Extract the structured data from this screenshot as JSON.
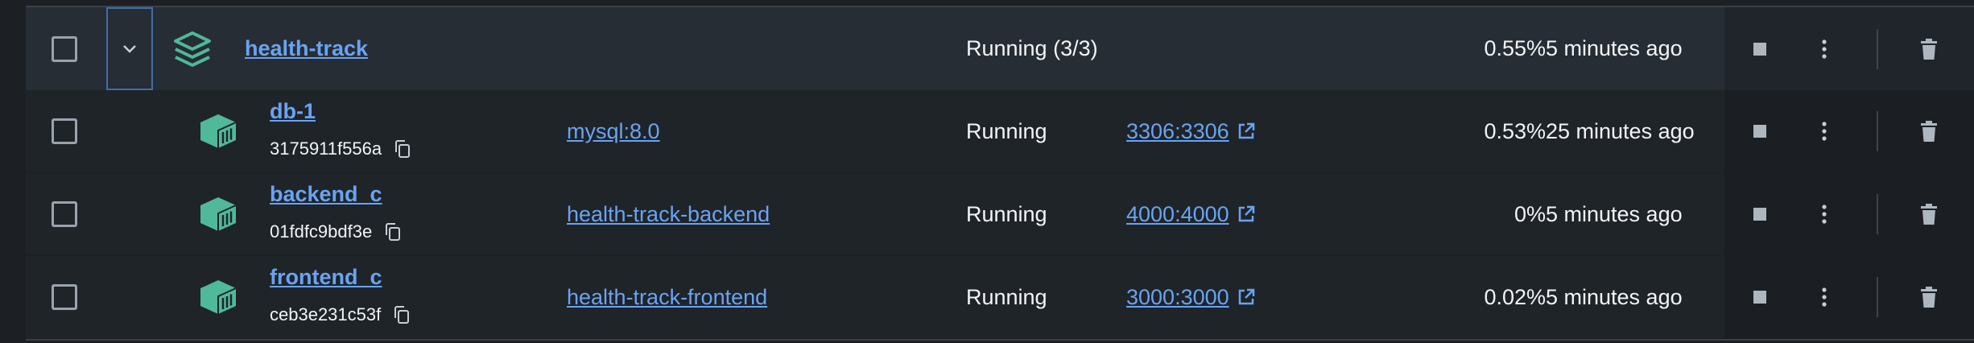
{
  "group": {
    "name": "health-track",
    "status": "Running (3/3)",
    "cpu": "0.55%",
    "last_started": "5 minutes ago"
  },
  "containers": [
    {
      "name": "db-1",
      "id": "3175911f556a",
      "image": "mysql:8.0",
      "status": "Running",
      "port": "3306:3306",
      "cpu": "0.53%",
      "last_started": "25 minutes ago"
    },
    {
      "name": "backend_c",
      "id": "01fdfc9bdf3e",
      "image": "health-track-backend",
      "status": "Running",
      "port": "4000:4000",
      "cpu": "0%",
      "last_started": "5 minutes ago"
    },
    {
      "name": "frontend_c",
      "id": "ceb3e231c53f",
      "image": "health-track-frontend",
      "status": "Running",
      "port": "3000:3000",
      "cpu": "0.02%",
      "last_started": "5 minutes ago"
    }
  ],
  "icons": {
    "group": "stack-layers-icon",
    "container": "container-cube-icon",
    "expand": "chevron-down-icon",
    "copy": "copy-icon",
    "external": "external-link-icon",
    "stop": "stop-icon",
    "more": "more-vertical-icon",
    "delete": "trash-icon"
  },
  "colors": {
    "accent_link": "#6aa3f2",
    "container_icon": "#4fb99a",
    "group_row_bg": "#272d35",
    "row_bg": "#1f2429"
  }
}
